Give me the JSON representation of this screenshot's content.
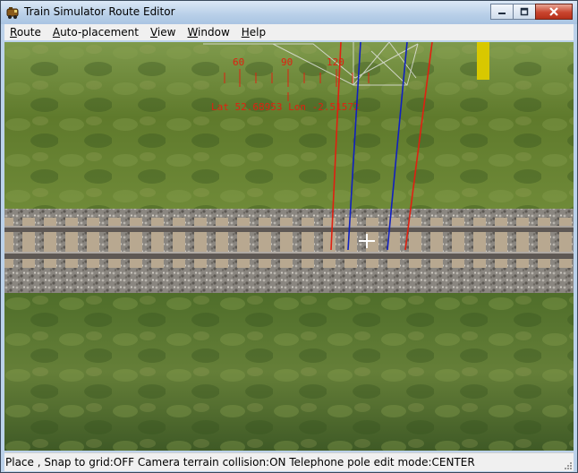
{
  "window": {
    "title": "Train Simulator Route Editor",
    "controls": {
      "minimize": "minimize",
      "maximize": "maximize",
      "close": "close"
    }
  },
  "menu": {
    "items": [
      {
        "accel": "R",
        "rest": "oute"
      },
      {
        "accel": "A",
        "rest": "uto-placement"
      },
      {
        "accel": "V",
        "rest": "iew"
      },
      {
        "accel": "W",
        "rest": "indow"
      },
      {
        "accel": "H",
        "rest": "elp"
      }
    ]
  },
  "viewport": {
    "compass_labels": [
      "60",
      "90",
      "120"
    ],
    "coordinates": "Lat 52.68953 Lon -2.51572"
  },
  "status": {
    "text": "Place , Snap to grid:OFF Camera terrain collision:ON Telephone pole edit mode:CENTER"
  },
  "colors": {
    "grass_dark": "#3f5a1f",
    "grass_light": "#8a9a4a",
    "ballast": "#8c8880",
    "rail": "#6a6460",
    "overlay_red": "#e02010",
    "overlay_blue": "#1020c0",
    "marker_yellow": "#d8c800"
  }
}
